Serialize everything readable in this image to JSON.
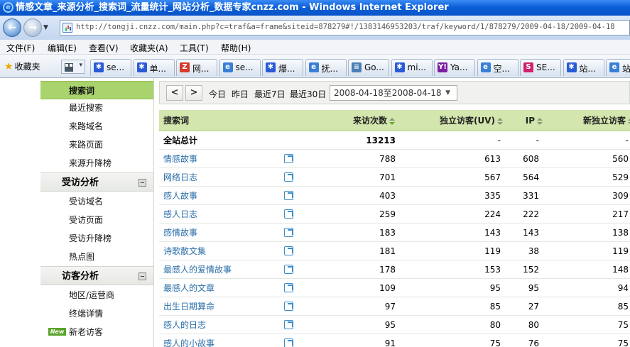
{
  "window": {
    "title": "情感文章_来源分析_搜索词_流量统计_网站分析_数据专家cnzz.com - Windows Internet Explorer"
  },
  "address": {
    "url": "http://tongji.cnzz.com/main.php?c=traf&a=frame&siteid=878279#!/1383146953203/traf/keyword/1/878279/2009-04-18/2009-04-18"
  },
  "menu": [
    "文件(F)",
    "编辑(E)",
    "查看(V)",
    "收藏夹(A)",
    "工具(T)",
    "帮助(H)"
  ],
  "favorites": {
    "label": "收藏夹"
  },
  "tabs": [
    {
      "label": "se...",
      "icon": "paw-icon",
      "color": "#2a5bd7"
    },
    {
      "label": "单...",
      "icon": "paw-icon",
      "color": "#2a5bd7"
    },
    {
      "label": "网...",
      "icon": "z-icon",
      "color": "#d63a2a"
    },
    {
      "label": "se...",
      "icon": "ie-icon",
      "color": "#3a7fd5"
    },
    {
      "label": "爆...",
      "icon": "paw-icon",
      "color": "#2a5bd7"
    },
    {
      "label": "抚...",
      "icon": "ie-icon",
      "color": "#3a7fd5"
    },
    {
      "label": "Go...",
      "icon": "doc-icon",
      "color": "#4b7fb5"
    },
    {
      "label": "mi...",
      "icon": "paw-icon",
      "color": "#2a5bd7"
    },
    {
      "label": "Ya...",
      "icon": "yahoo-icon",
      "color": "#7b1fa2"
    },
    {
      "label": "空...",
      "icon": "ie-icon",
      "color": "#3a7fd5"
    },
    {
      "label": "SE...",
      "icon": "s-icon",
      "color": "#d0206c"
    },
    {
      "label": "站...",
      "icon": "paw-icon",
      "color": "#2a5bd7"
    },
    {
      "label": "站",
      "icon": "ie-icon",
      "color": "#3a7fd5"
    }
  ],
  "sidebar": {
    "items_top": [
      "搜索词",
      "最近搜索",
      "来路域名",
      "来路页面",
      "来源升降榜"
    ],
    "section_visit": {
      "title": "受访分析",
      "items": [
        "受访域名",
        "受访页面",
        "受访升降榜",
        "热点图"
      ]
    },
    "section_visitor": {
      "title": "访客分析",
      "items": [
        "地区/运营商",
        "终端详情",
        "新老访客"
      ],
      "badge": "New"
    }
  },
  "toolbar": {
    "prev": "<",
    "next": ">",
    "quick": [
      "今日",
      "昨日",
      "最近7日",
      "最近30日"
    ],
    "daterange": "2008-04-18至2008-04-18"
  },
  "table": {
    "headers": {
      "keyword": "搜索词",
      "visits": "来访次数",
      "uv": "独立访客(UV)",
      "ip": "IP",
      "new_uv": "新独立访客"
    },
    "total": {
      "keyword": "全站总计",
      "visits": "13213",
      "uv": "-",
      "ip": "-",
      "new_uv": "-"
    },
    "rows": [
      {
        "keyword": "情感故事",
        "visits": "788",
        "uv": "613",
        "ip": "608",
        "new_uv": "560"
      },
      {
        "keyword": "网络日志",
        "visits": "701",
        "uv": "567",
        "ip": "564",
        "new_uv": "529"
      },
      {
        "keyword": "感人故事",
        "visits": "403",
        "uv": "335",
        "ip": "331",
        "new_uv": "309"
      },
      {
        "keyword": "感人日志",
        "visits": "259",
        "uv": "224",
        "ip": "222",
        "new_uv": "217"
      },
      {
        "keyword": "感情故事",
        "visits": "183",
        "uv": "143",
        "ip": "143",
        "new_uv": "138"
      },
      {
        "keyword": "诗歌散文集",
        "visits": "181",
        "uv": "119",
        "ip": "38",
        "new_uv": "119"
      },
      {
        "keyword": "最感人的爱情故事",
        "visits": "178",
        "uv": "153",
        "ip": "152",
        "new_uv": "148"
      },
      {
        "keyword": "最感人的文章",
        "visits": "109",
        "uv": "95",
        "ip": "95",
        "new_uv": "94"
      },
      {
        "keyword": "出生日期算命",
        "visits": "97",
        "uv": "85",
        "ip": "27",
        "new_uv": "85"
      },
      {
        "keyword": "感人的日志",
        "visits": "95",
        "uv": "80",
        "ip": "80",
        "new_uv": "75"
      },
      {
        "keyword": "感人的小故事",
        "visits": "91",
        "uv": "75",
        "ip": "76",
        "new_uv": "75"
      }
    ]
  }
}
